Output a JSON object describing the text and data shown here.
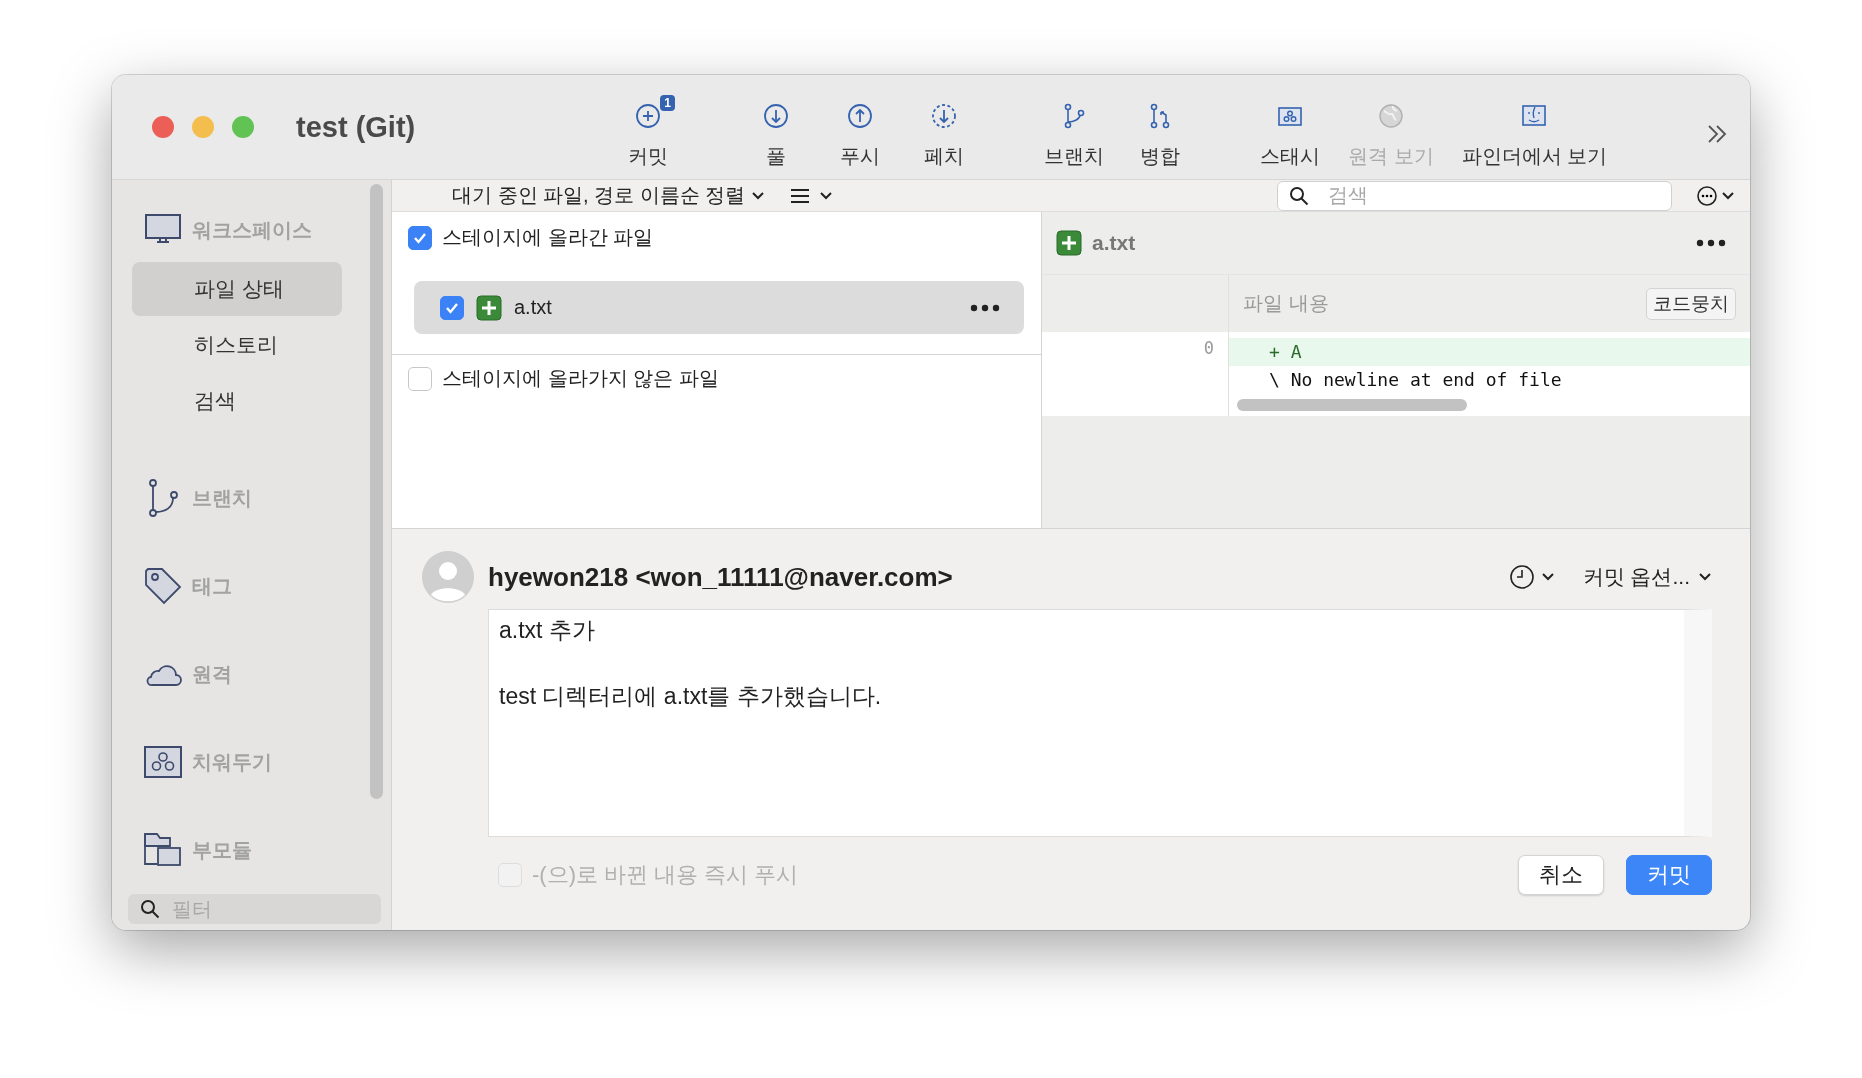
{
  "window": {
    "title": "test (Git)"
  },
  "toolbar": [
    {
      "label": "커밋",
      "badge": "1",
      "disabled": false
    },
    {
      "label": "풀",
      "disabled": false
    },
    {
      "label": "푸시",
      "disabled": false
    },
    {
      "label": "페치",
      "disabled": false
    },
    {
      "label": "브랜치",
      "disabled": false
    },
    {
      "label": "병합",
      "disabled": false
    },
    {
      "label": "스태시",
      "disabled": false
    },
    {
      "label": "원격 보기",
      "disabled": true
    },
    {
      "label": "파인더에서 보기",
      "disabled": false
    }
  ],
  "sidebar": {
    "sections": [
      {
        "kind": "workspace",
        "label": "워크스페이스",
        "children": [
          {
            "label": "파일 상태",
            "selected": true
          },
          {
            "label": "히스토리",
            "selected": false
          },
          {
            "label": "검색",
            "selected": false
          }
        ]
      },
      {
        "kind": "branch",
        "label": "브랜치"
      },
      {
        "kind": "tag",
        "label": "태그"
      },
      {
        "kind": "remote",
        "label": "원격"
      },
      {
        "kind": "stash",
        "label": "치워두기"
      },
      {
        "kind": "submodule",
        "label": "부모듈"
      }
    ],
    "filter": {
      "placeholder": "필터"
    }
  },
  "file_list": {
    "sort_label": "대기 중인 파일, 경로 이름순 정렬",
    "search": {
      "placeholder": "검색"
    },
    "staged": {
      "label": "스테이지에 올라간 파일",
      "checked": true,
      "files": [
        {
          "name": "a.txt",
          "checked": true,
          "selected": true
        }
      ]
    },
    "unstaged": {
      "label": "스테이지에 올라가지 않은 파일",
      "checked": false
    }
  },
  "diff": {
    "file": "a.txt",
    "header": "파일 내용",
    "hunk_button": "코드뭉치",
    "lines": [
      {
        "kind": "added",
        "number": "0",
        "marker": "+",
        "text": "A"
      },
      {
        "kind": "note",
        "marker": "\\",
        "text": "No newline at end of file"
      }
    ]
  },
  "commit": {
    "author": "hyewon218 <won_11111@naver.com>",
    "options": "커밋 옵션...",
    "message": "a.txt 추가\n\ntest 디렉터리에 a.txt를 추가했습니다.",
    "push_option": {
      "label": "-(으)로 바뀐 내용 즉시 푸시",
      "checked": false,
      "disabled": true
    },
    "buttons": [
      {
        "label": "취소",
        "kind": "secondary"
      },
      {
        "label": "커밋",
        "kind": "primary"
      }
    ]
  }
}
